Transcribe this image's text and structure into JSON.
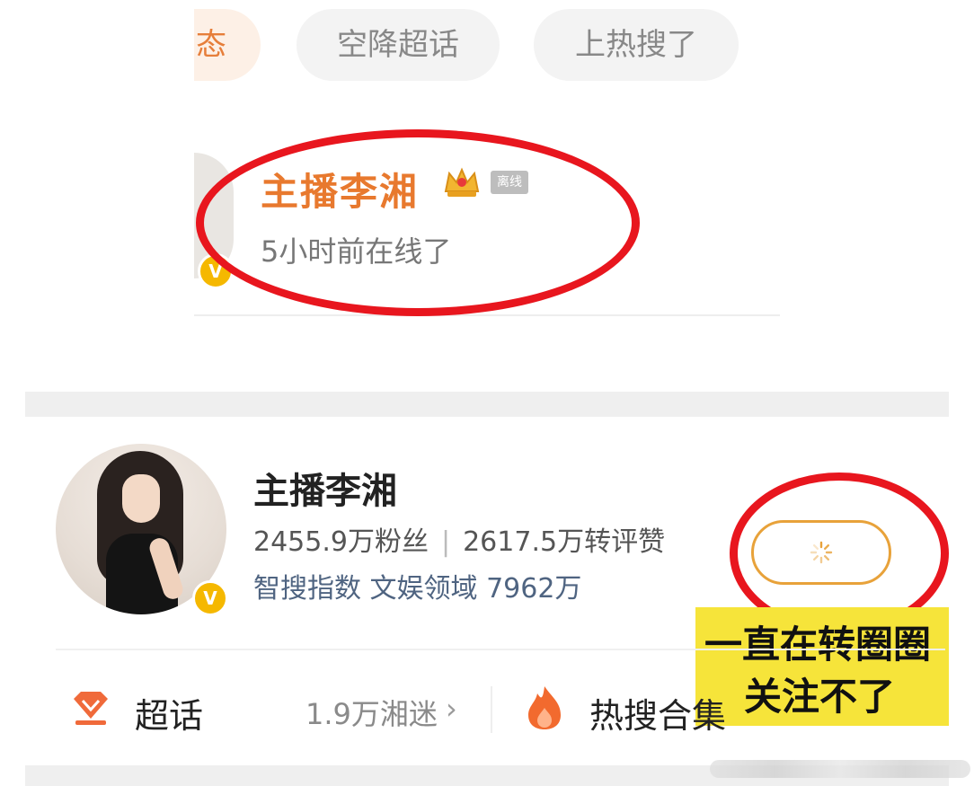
{
  "chips": {
    "partial_label": "态",
    "airdrop_label": "空降超话",
    "hot_search_label": "上热搜了"
  },
  "top_card": {
    "name": "主播李湘",
    "offline_tag": "离线",
    "online_status": "5小时前在线了"
  },
  "profile": {
    "name": "主播李湘",
    "followers": "2455.9万粉丝",
    "separator": "|",
    "interactions": "2617.5万转评赞",
    "index_line": "智搜指数 文娱领域 7962万",
    "verified_badge": "V"
  },
  "follow_button": {
    "state": "loading"
  },
  "annotation": {
    "line1": "一直在转圈圈",
    "line2": "关注不了"
  },
  "bottom_links": {
    "supertopic_label": "超话",
    "supertopic_fans": "1.9万湘迷",
    "chevron": "›",
    "hot_collection_label": "热搜合集"
  },
  "colors": {
    "accent_orange": "#e8792e",
    "red_circle": "#e8161e",
    "follow_border": "#e8a23a",
    "annotation_yellow": "#f6e43a",
    "verified": "#f5b800"
  }
}
